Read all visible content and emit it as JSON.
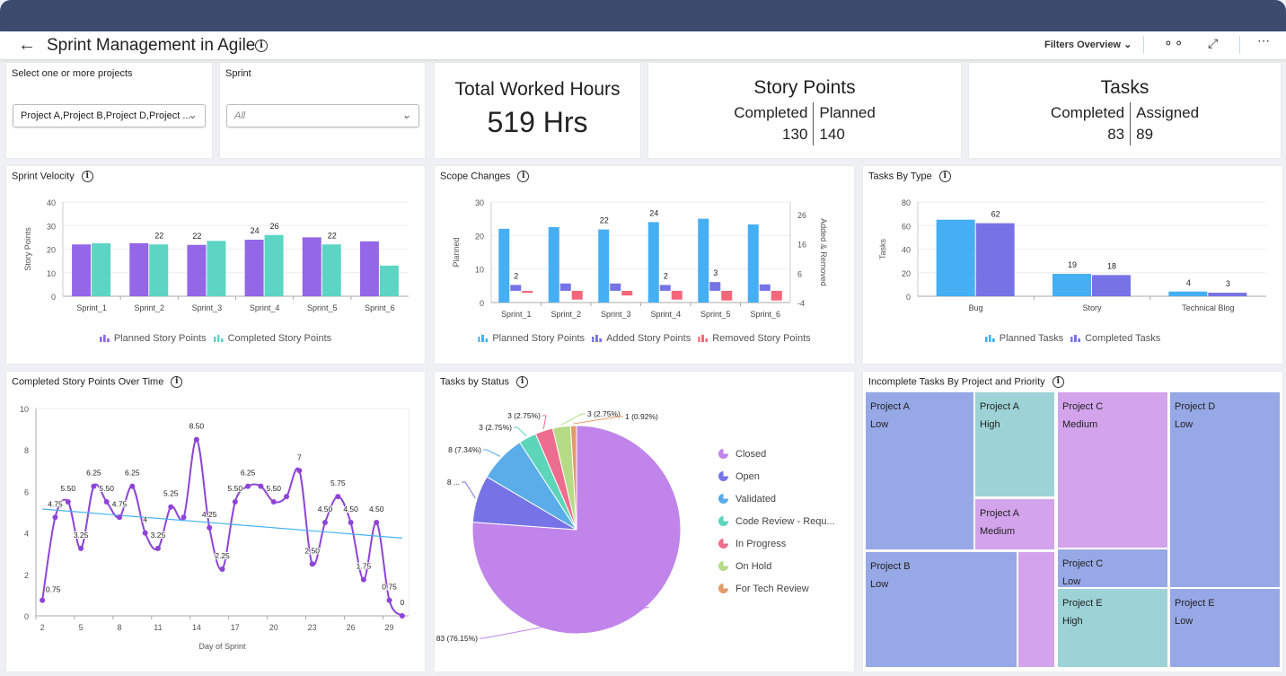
{
  "header": {
    "title": "Sprint Management in Agile",
    "back_icon": "arrow-left-icon",
    "filters_label": "Filters Overview",
    "icons": [
      "glasses-icon",
      "expand-icon",
      "more-icon"
    ]
  },
  "filters": {
    "projects_label": "Select one or more projects",
    "projects_value": "Project A,Project B,Project D,Project ...",
    "sprint_label": "Sprint",
    "sprint_placeholder": "All"
  },
  "kpis": {
    "hours": {
      "title": "Total Worked Hours",
      "value": "519 Hrs"
    },
    "story_points": {
      "title": "Story Points",
      "completed_label": "Completed",
      "planned_label": "Planned",
      "completed": "130",
      "planned": "140"
    },
    "tasks": {
      "title": "Tasks",
      "completed_label": "Completed",
      "assigned_label": "Assigned",
      "completed": "83",
      "assigned": "89"
    }
  },
  "colors": {
    "purple": "#9466e8",
    "teal": "#5dd5c4",
    "blue": "#46aef2",
    "indigo": "#7673e6",
    "red": "#f4677a",
    "line": "#8e44d6",
    "trend": "#45b3f5"
  },
  "chart_data": [
    {
      "id": "velocity",
      "type": "bar",
      "title": "Sprint Velocity",
      "ylabel": "Story Points",
      "ylim": [
        0,
        40
      ],
      "yticks": [
        0,
        10,
        20,
        30,
        40
      ],
      "categories": [
        "Sprint_1",
        "Sprint_2",
        "Sprint_3",
        "Sprint_4",
        "Sprint_5",
        "Sprint_6"
      ],
      "series": [
        {
          "name": "Planned Story Points",
          "color": "#9466e8",
          "values": [
            22,
            22.5,
            21.8,
            24,
            25,
            23.3
          ],
          "labels": [
            "",
            "",
            "22",
            "24",
            "",
            ""
          ]
        },
        {
          "name": "Completed Story Points",
          "color": "#5dd5c4",
          "values": [
            22.5,
            22,
            23.5,
            26,
            22,
            13
          ],
          "labels": [
            "",
            "22",
            "",
            "26",
            "22",
            ""
          ]
        }
      ]
    },
    {
      "id": "scope",
      "type": "bar",
      "title": "Scope Changes",
      "ylabel": "Planned",
      "y2label": "Added & Removed",
      "ylim": [
        0,
        30
      ],
      "yticks": [
        0,
        10,
        20,
        30
      ],
      "y2lim": [
        -4,
        30.3
      ],
      "y2ticks": [
        -4,
        6,
        16,
        26
      ],
      "categories": [
        "Sprint_1",
        "Sprint_2",
        "Sprint_3",
        "Sprint_4",
        "Sprint_5",
        "Sprint_6"
      ],
      "series": [
        {
          "name": "Planned Story Points",
          "color": "#46aef2",
          "axis": "left",
          "values": [
            22,
            22.5,
            21.8,
            24,
            25,
            23.3
          ],
          "labels": [
            "",
            "",
            "22",
            "24",
            "",
            ""
          ]
        },
        {
          "name": "Added Story Points",
          "color": "#7673e6",
          "axis": "right",
          "values": [
            2,
            2.5,
            2.5,
            2,
            3,
            2.2
          ],
          "labels": [
            "2",
            "",
            "",
            "2",
            "3",
            ""
          ]
        },
        {
          "name": "Removed Story Points",
          "color": "#f4677a",
          "axis": "right",
          "values": [
            -0.7,
            -3,
            -1.6,
            -3,
            -3.3,
            -3.3
          ],
          "labels": [
            "",
            "",
            "",
            "",
            "",
            ""
          ]
        }
      ]
    },
    {
      "id": "types",
      "type": "bar",
      "title": "Tasks By Type",
      "ylabel": "Tasks",
      "ylim": [
        0,
        80
      ],
      "yticks": [
        0,
        20,
        40,
        60,
        80
      ],
      "categories": [
        "Bug",
        "Story",
        "Technical Blog"
      ],
      "series": [
        {
          "name": "Planned Tasks",
          "color": "#46aef2",
          "values": [
            65,
            19,
            4
          ],
          "labels": [
            "",
            "19",
            "4"
          ]
        },
        {
          "name": "Completed Tasks",
          "color": "#7673e6",
          "values": [
            62,
            18,
            3
          ],
          "labels": [
            "62",
            "18",
            "3"
          ]
        }
      ]
    },
    {
      "id": "overtime",
      "type": "line",
      "title": "Completed Story Points Over Time",
      "xlabel": "Day of Sprint",
      "xlim": [
        1.5,
        30.5
      ],
      "xticks": [
        2,
        5,
        8,
        11,
        14,
        17,
        20,
        23,
        26,
        29
      ],
      "ylim": [
        0,
        10
      ],
      "yticks": [
        0,
        2,
        4,
        6,
        8,
        10
      ],
      "x": [
        2,
        3,
        4,
        5,
        6,
        7,
        8,
        9,
        10,
        11,
        12,
        13,
        14,
        15,
        16,
        17,
        18,
        19,
        20,
        21,
        22,
        23,
        24,
        25,
        26,
        27,
        28,
        29,
        30
      ],
      "y": [
        0.75,
        4.75,
        5.5,
        3.25,
        6.25,
        5.5,
        4.75,
        6.25,
        4,
        3.25,
        5.25,
        4.75,
        8.5,
        4.25,
        2.25,
        5.5,
        6.25,
        6.25,
        5.5,
        5.75,
        7,
        2.5,
        4.5,
        5.75,
        4.5,
        1.75,
        4.5,
        0.75,
        0
      ],
      "labels": [
        "0.75",
        "4.75",
        "5.50",
        "3.25",
        "6.25",
        "5.50",
        "4.75",
        "6.25",
        "4",
        "3.25",
        "5.25",
        "",
        "8.50",
        "4.25",
        "2.25",
        "5.50",
        "6.25",
        "",
        "5.50",
        "",
        "7",
        "2.50",
        "4.50",
        "5.75",
        "4.50",
        "1.75",
        "4.50",
        "0.75",
        "0"
      ],
      "trend": {
        "x": [
          2,
          30
        ],
        "y": [
          5.15,
          3.75
        ]
      }
    },
    {
      "id": "status",
      "type": "pie",
      "title": "Tasks by Status",
      "slices": [
        {
          "name": "Closed",
          "value": 83,
          "label": "83 (76.15%)",
          "color": "#c084ea"
        },
        {
          "name": "Open",
          "value": 8,
          "label": "8 ...",
          "color": "#7673e6"
        },
        {
          "name": "Validated",
          "value": 8,
          "label": "8 (7.34%)",
          "color": "#5aade8"
        },
        {
          "name": "Code Review - Requ...",
          "value": 3,
          "label": "3 (2.75%)",
          "color": "#5dd5b8"
        },
        {
          "name": "In Progress",
          "value": 3,
          "label": "3 (2.75%)",
          "color": "#ec6d8e"
        },
        {
          "name": "On Hold",
          "value": 3,
          "label": "3 (2.75%)",
          "color": "#b5db86"
        },
        {
          "name": "For Tech Review",
          "value": 1,
          "label": "1 (0.92%)",
          "color": "#e39a6a"
        }
      ]
    }
  ],
  "treemap": {
    "title": "Incomplete Tasks By Project and Priority",
    "cells": [
      {
        "project": "Project A",
        "priority": "Low"
      },
      {
        "project": "Project A",
        "priority": "High"
      },
      {
        "project": "Project A",
        "priority": "Medium"
      },
      {
        "project": "Project C",
        "priority": "Medium"
      },
      {
        "project": "Project D",
        "priority": "Low"
      },
      {
        "project": "Project B",
        "priority": "Low"
      },
      {
        "project": "",
        "priority": ""
      },
      {
        "project": "Project C",
        "priority": "Low"
      },
      {
        "project": "Project E",
        "priority": "High"
      },
      {
        "project": "Project E",
        "priority": "Low"
      }
    ]
  }
}
